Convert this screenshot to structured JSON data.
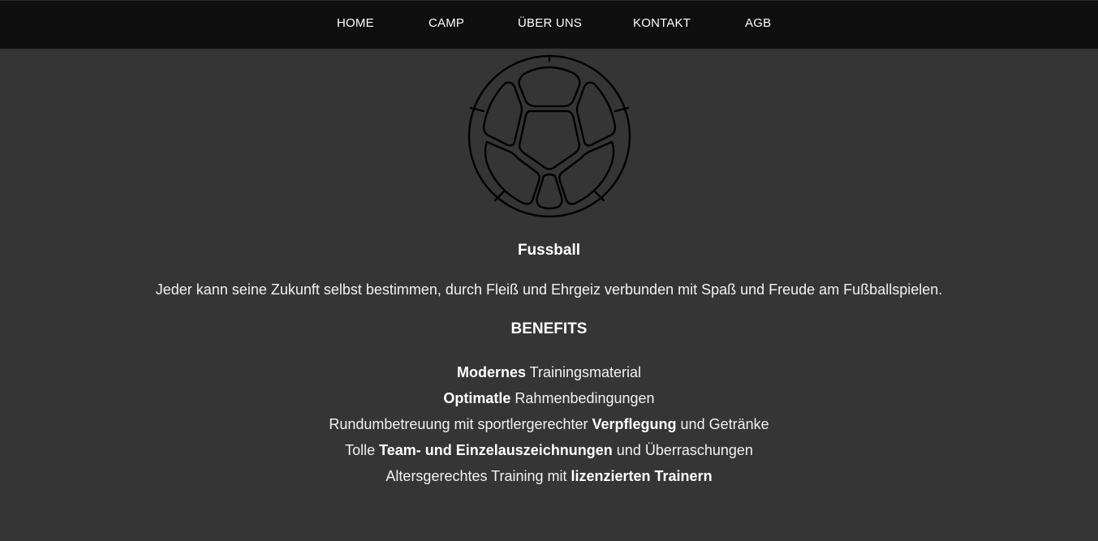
{
  "nav": {
    "items": [
      {
        "label": "HOME"
      },
      {
        "label": "CAMP"
      },
      {
        "label": "ÜBER UNS"
      },
      {
        "label": "KONTAKT"
      },
      {
        "label": "AGB"
      }
    ]
  },
  "hero": {
    "icon": "football-icon",
    "title": "Fussball",
    "intro": "Jeder kann seine Zukunft selbst bestimmen, durch Fleiß und Ehrgeiz verbunden mit Spaß und Freude am Fußballspielen."
  },
  "benefits": {
    "heading": "BENEFITS",
    "items": [
      {
        "pre": "",
        "bold": "Modernes",
        "post": " Trainingsmaterial"
      },
      {
        "pre": "",
        "bold": "Optimatle",
        "post": " Rahmenbedingungen"
      },
      {
        "pre": "Rundumbetreuung mit sportlergerechter ",
        "bold": "Verpflegung",
        "post": " und Getränke"
      },
      {
        "pre": "Tolle ",
        "bold": "Team- und Einzelauszeichnungen",
        "post": " und Überraschungen"
      },
      {
        "pre": "Altersgerechtes Training mit ",
        "bold": "lizenzierten Trainern",
        "post": ""
      }
    ]
  },
  "colors": {
    "page_background": "#353535",
    "nav_background": "#0f0f0f",
    "text": "#f2f2f2"
  }
}
